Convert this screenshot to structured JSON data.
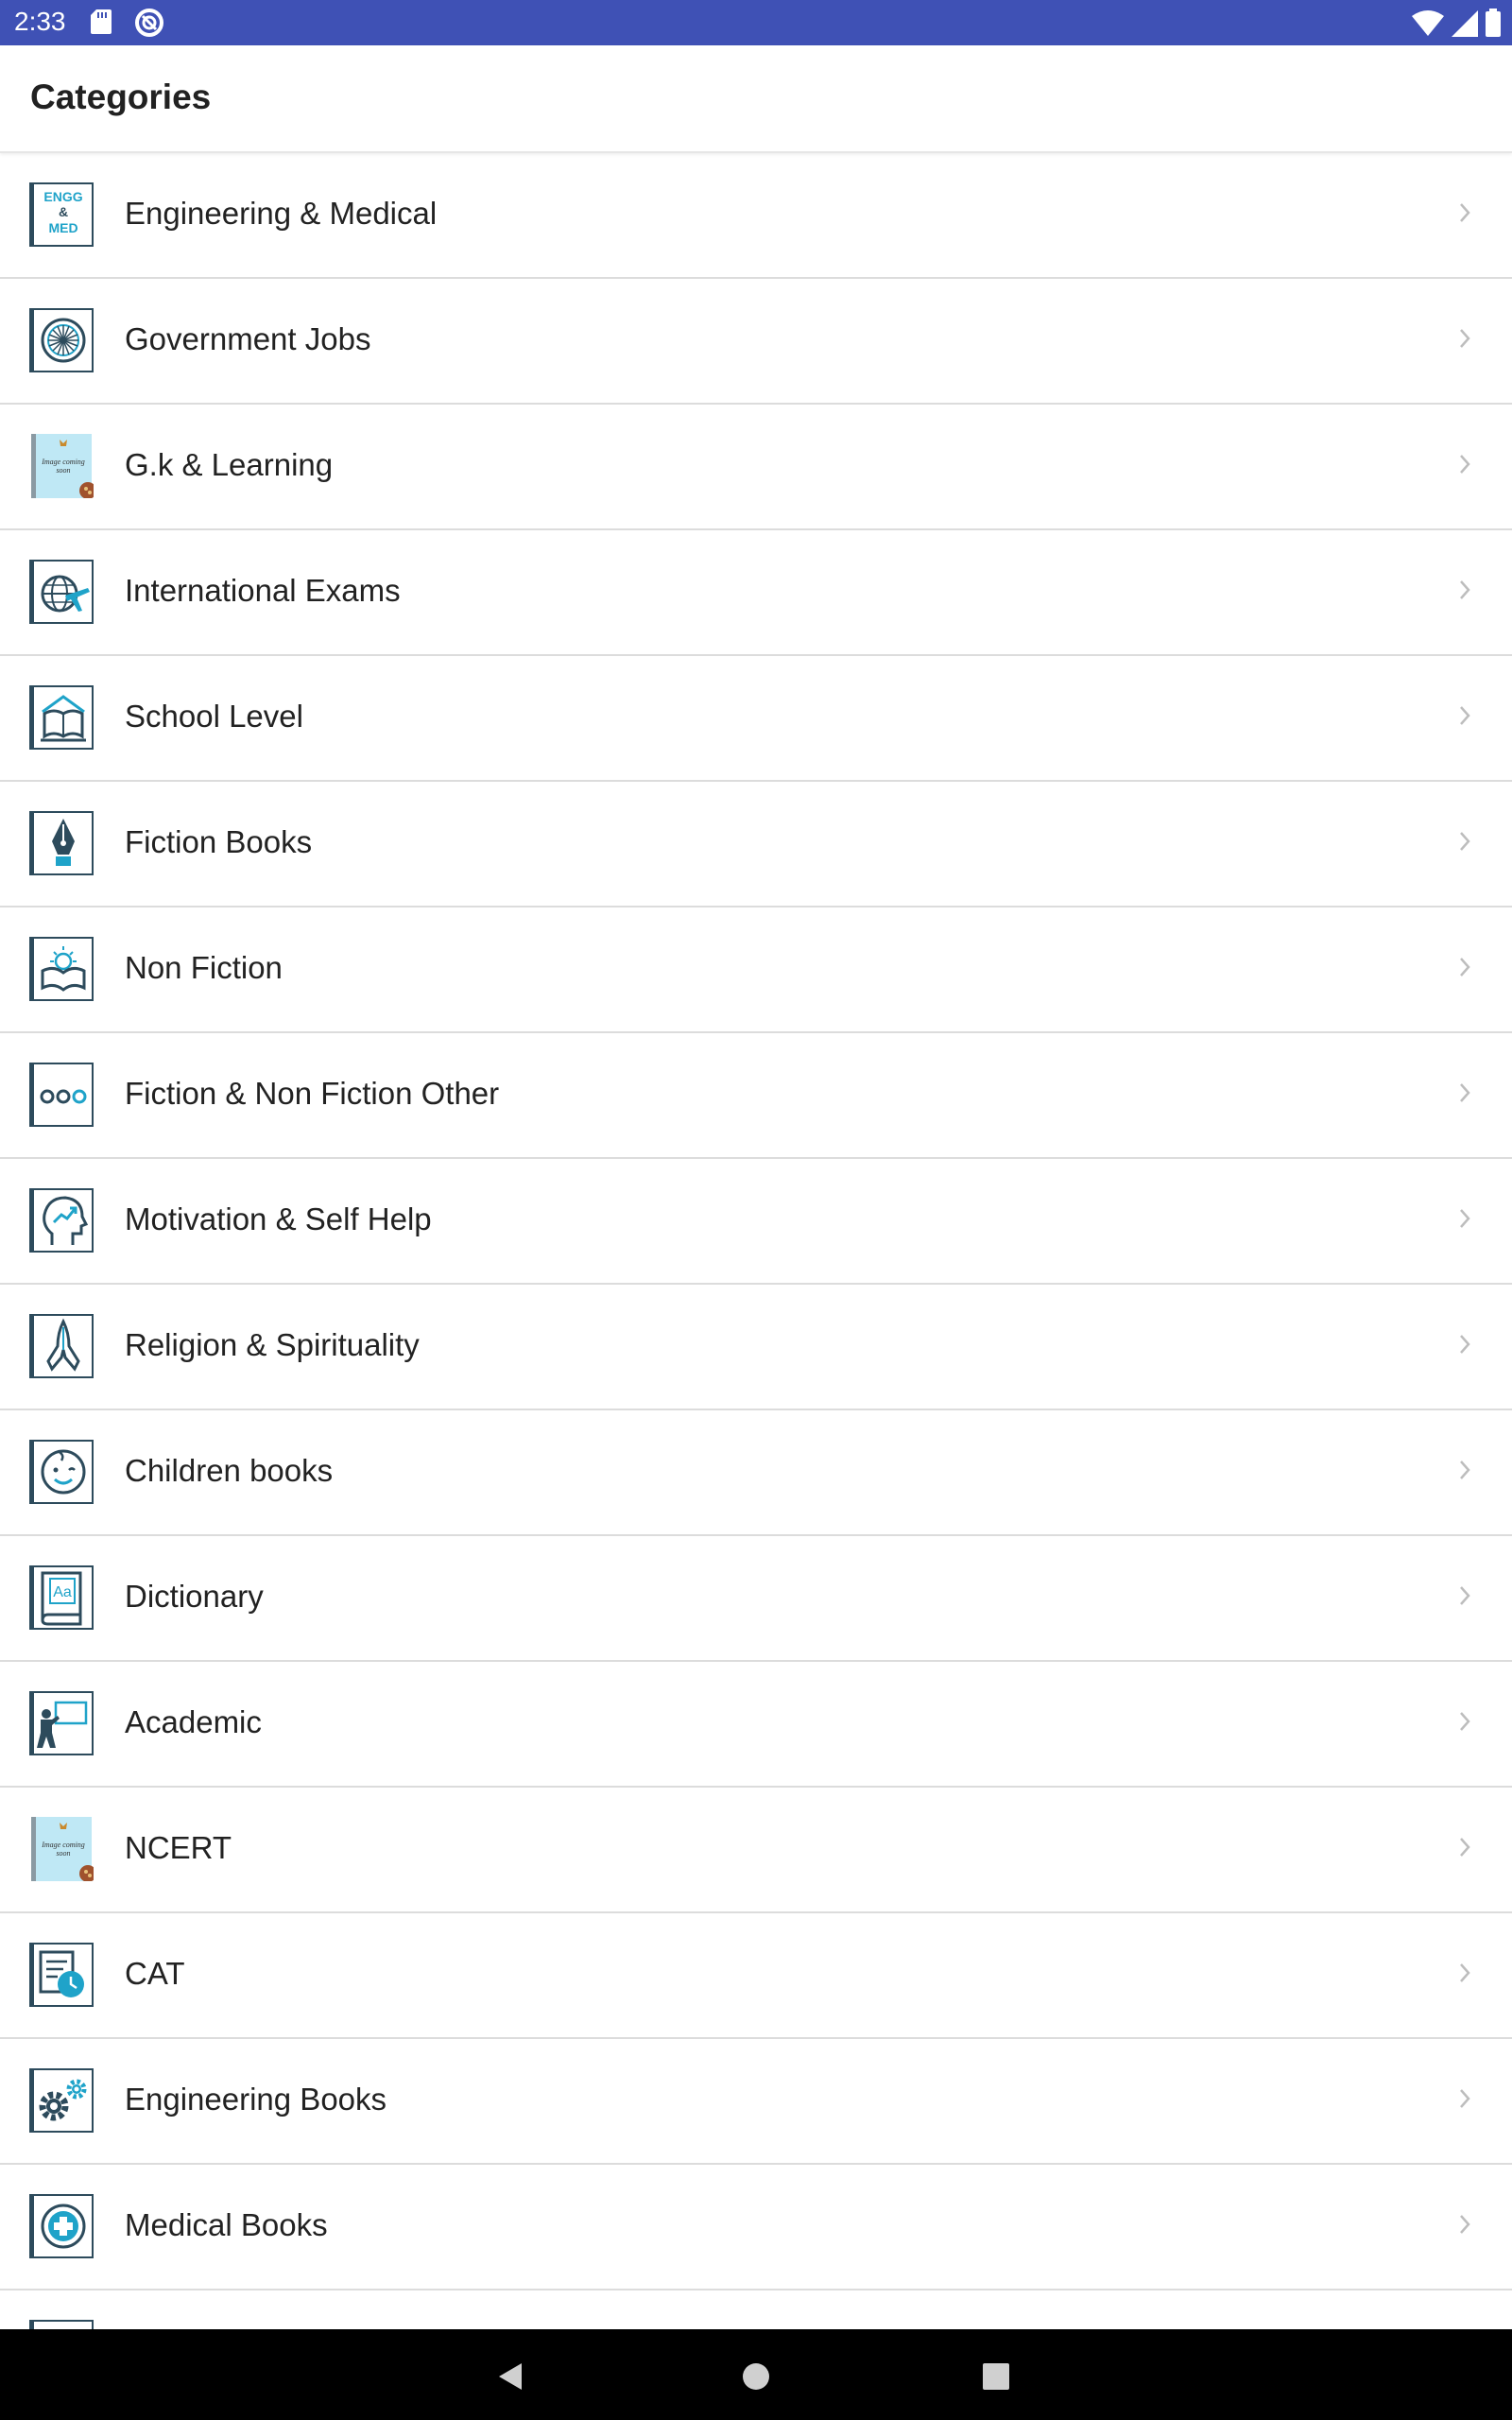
{
  "status": {
    "time": "2:33",
    "icons": [
      "sd-card-icon",
      "sync-icon",
      "wifi-icon",
      "signal-icon",
      "battery-icon"
    ]
  },
  "header": {
    "title": "Categories"
  },
  "categories": [
    {
      "label": "Engineering & Medical",
      "icon": "engg-med-icon",
      "icon_text": [
        "ENGG",
        "&",
        "MED"
      ]
    },
    {
      "label": "Government Jobs",
      "icon": "ashoka-chakra-icon"
    },
    {
      "label": "G.k & Learning",
      "icon": "image-coming-soon-icon",
      "icon_text": [
        "Image coming",
        "soon"
      ]
    },
    {
      "label": "International Exams",
      "icon": "globe-plane-icon"
    },
    {
      "label": "School Level",
      "icon": "open-book-house-icon"
    },
    {
      "label": "Fiction Books",
      "icon": "pen-nib-icon"
    },
    {
      "label": "Non Fiction",
      "icon": "book-sun-icon"
    },
    {
      "label": "Fiction & Non Fiction Other",
      "icon": "three-circles-icon"
    },
    {
      "label": "Motivation & Self Help",
      "icon": "head-growth-icon"
    },
    {
      "label": "Religion & Spirituality",
      "icon": "praying-hands-icon"
    },
    {
      "label": "Children books",
      "icon": "child-face-icon"
    },
    {
      "label": "Dictionary",
      "icon": "dictionary-icon",
      "icon_text": [
        "Aa"
      ]
    },
    {
      "label": "Academic",
      "icon": "teacher-board-icon"
    },
    {
      "label": "NCERT",
      "icon": "image-coming-soon-icon",
      "icon_text": [
        "Image coming",
        "soon"
      ]
    },
    {
      "label": "CAT",
      "icon": "checklist-clock-icon"
    },
    {
      "label": "Engineering Books",
      "icon": "gears-icon"
    },
    {
      "label": "Medical Books",
      "icon": "medical-cross-icon"
    }
  ],
  "colors": {
    "status_bar": "#3f51b5",
    "icon_dark": "#2d4b5c",
    "icon_accent": "#1fa3c9",
    "divider": "#dcdcdc",
    "nav_bar": "#000000"
  },
  "nav": {
    "buttons": [
      "back-icon",
      "home-icon",
      "recents-icon"
    ]
  }
}
